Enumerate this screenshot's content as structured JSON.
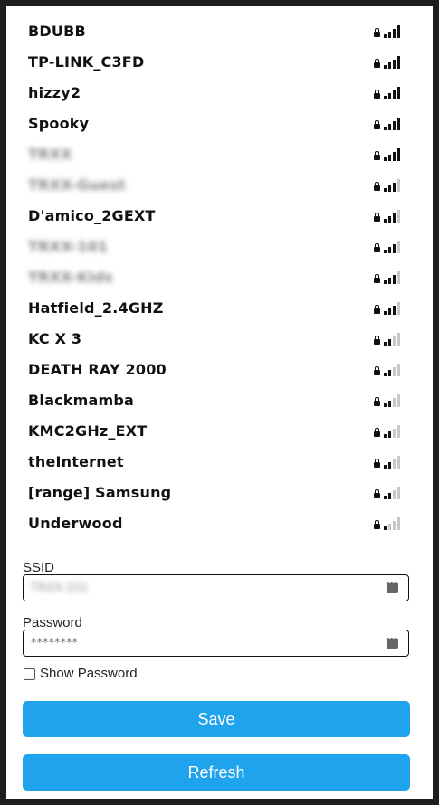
{
  "networks": [
    {
      "name": "BDUBB",
      "locked": true,
      "signal": 4,
      "blurred": false
    },
    {
      "name": "TP-LINK_C3FD",
      "locked": true,
      "signal": 4,
      "blurred": false
    },
    {
      "name": "hizzy2",
      "locked": true,
      "signal": 4,
      "blurred": false
    },
    {
      "name": "Spooky",
      "locked": true,
      "signal": 4,
      "blurred": false
    },
    {
      "name": "TRXX",
      "locked": true,
      "signal": 4,
      "blurred": true
    },
    {
      "name": "TRXX-Guest",
      "locked": true,
      "signal": 3,
      "blurred": true
    },
    {
      "name": "D'amico_2GEXT",
      "locked": true,
      "signal": 3,
      "blurred": false
    },
    {
      "name": "TRXX-101",
      "locked": true,
      "signal": 3,
      "blurred": true
    },
    {
      "name": "TRXX-Kids",
      "locked": true,
      "signal": 3,
      "blurred": true
    },
    {
      "name": "Hatfield_2.4GHZ",
      "locked": true,
      "signal": 3,
      "blurred": false
    },
    {
      "name": "KC X 3",
      "locked": true,
      "signal": 2,
      "blurred": false
    },
    {
      "name": "DEATH RAY 2000",
      "locked": true,
      "signal": 2,
      "blurred": false
    },
    {
      "name": "Blackmamba",
      "locked": true,
      "signal": 2,
      "blurred": false
    },
    {
      "name": "KMC2GHz_EXT",
      "locked": true,
      "signal": 2,
      "blurred": false
    },
    {
      "name": "theInternet",
      "locked": true,
      "signal": 2,
      "blurred": false
    },
    {
      "name": "[range] Samsung",
      "locked": true,
      "signal": 2,
      "blurred": false
    },
    {
      "name": "Underwood",
      "locked": true,
      "signal": 1,
      "blurred": false
    }
  ],
  "form": {
    "ssid_label": "SSID",
    "ssid_value": "TRXX-101",
    "password_label": "Password",
    "password_value": "********",
    "show_password_label": "Show Password",
    "show_password_checked": false
  },
  "buttons": {
    "save": "Save",
    "refresh": "Refresh"
  },
  "colors": {
    "button": "#1fa3ec",
    "background": "#ffffff",
    "frame": "#1e1e1e"
  }
}
